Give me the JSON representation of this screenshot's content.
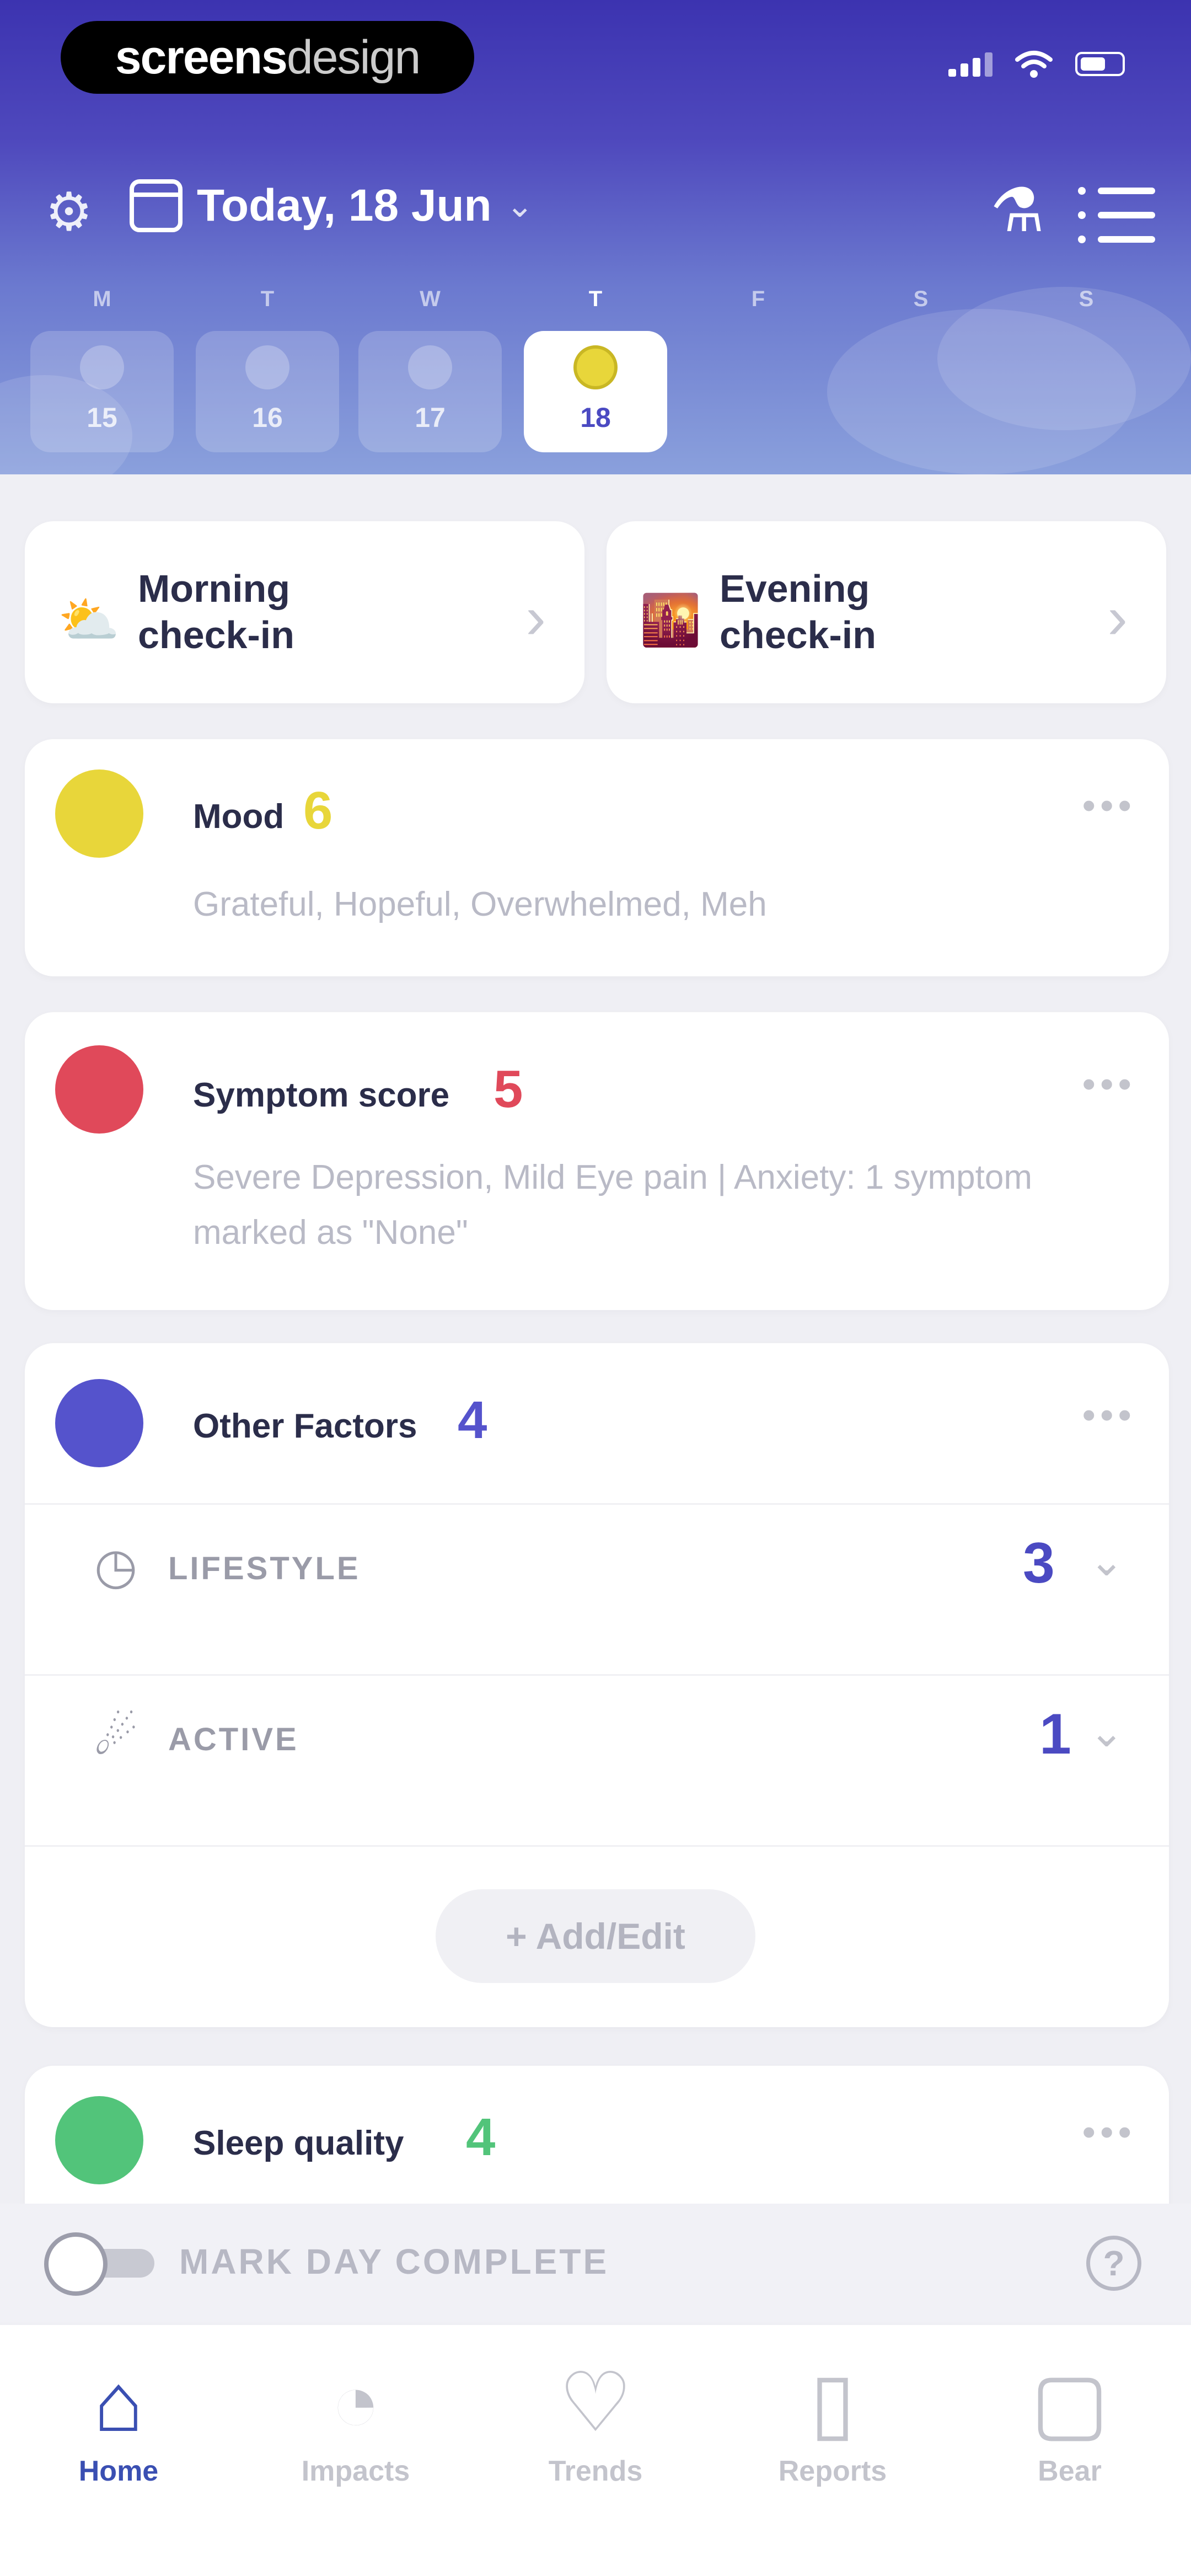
{
  "status_bar": {
    "brand_bold": "screens",
    "brand_light": "design"
  },
  "header": {
    "date_label": "Today, 18 Jun",
    "icons": [
      "gear-icon",
      "calendar-icon",
      "chevron-down-icon",
      "flask-icon",
      "menu-list-icon"
    ],
    "weekdays": [
      "M",
      "T",
      "W",
      "T",
      "F",
      "S",
      "S"
    ],
    "days": [
      {
        "num": "15"
      },
      {
        "num": "16"
      },
      {
        "num": "17"
      },
      {
        "num": "18",
        "active": true
      }
    ]
  },
  "checkins": {
    "morning": "Morning check-in",
    "evening": "Evening check-in"
  },
  "mood": {
    "title": "Mood",
    "score": "6",
    "details": "Grateful, Hopeful, Overwhelmed, Meh",
    "color": "#e8d63a"
  },
  "symptom": {
    "title": "Symptom score",
    "score": "5",
    "details": "Severe Depression, Mild Eye pain | Anxiety: 1 symptom marked as \"None\"",
    "color": "#e0495a"
  },
  "other_factors": {
    "title": "Other Factors",
    "score": "4",
    "color": "#5553cc",
    "rows": [
      {
        "label": "LIFESTYLE",
        "count": "3"
      },
      {
        "label": "ACTIVE",
        "count": "1"
      }
    ],
    "add_label": "+ Add/Edit"
  },
  "sleep": {
    "title": "Sleep quality",
    "score": "4",
    "color": "#52c47a"
  },
  "mark_day": {
    "label": "MARK DAY COMPLETE"
  },
  "tabs": [
    {
      "label": "Home",
      "icon": "home-icon",
      "active": true
    },
    {
      "label": "Impacts",
      "icon": "gauge-icon"
    },
    {
      "label": "Trends",
      "icon": "heart-trend-icon"
    },
    {
      "label": "Reports",
      "icon": "report-icon"
    },
    {
      "label": "Bear",
      "icon": "bear-icon"
    }
  ]
}
